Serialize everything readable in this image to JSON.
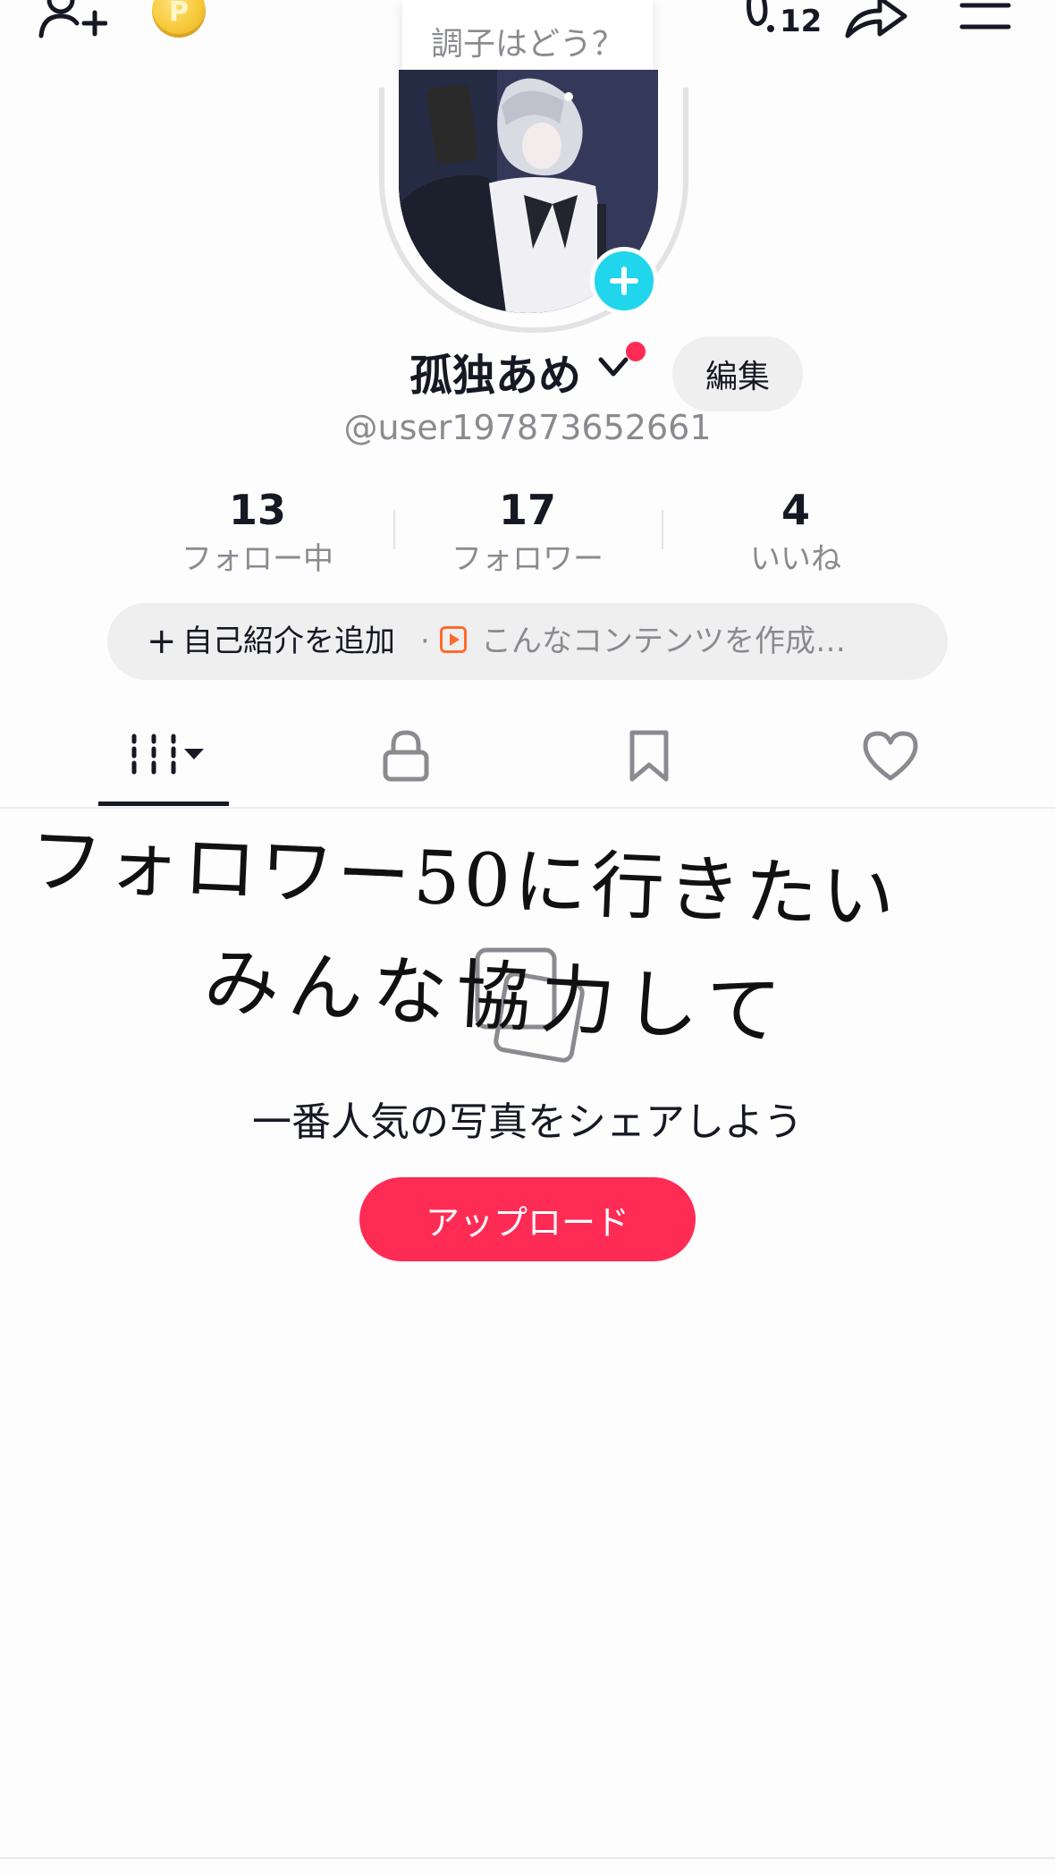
{
  "header": {
    "add_friend_icon": "person-plus-icon",
    "coin_icon": "coin-icon",
    "coin_letter": "P",
    "footprint_count": "12",
    "share_icon": "share-arrow-icon",
    "menu_icon": "hamburger-icon"
  },
  "status_bubble": {
    "text": "調子はどう？"
  },
  "profile": {
    "name": "孤独あめ",
    "edit_label": "編集",
    "handle": "@user197873652661"
  },
  "stats": [
    {
      "value": "13",
      "label": "フォロー中"
    },
    {
      "value": "17",
      "label": "フォロワー"
    },
    {
      "value": "4",
      "label": "いいね"
    }
  ],
  "bio": {
    "plus": "+",
    "add_label": "自己紹介を追加",
    "separator": "·",
    "promo_label": "こんなコンテンツを作成…"
  },
  "tabs": [
    {
      "icon": "grid-icon",
      "active": true
    },
    {
      "icon": "lock-icon",
      "active": false
    },
    {
      "icon": "bookmark-icon",
      "active": false
    },
    {
      "icon": "heart-icon",
      "active": false
    }
  ],
  "overlay_handwriting": {
    "line1": "フォロワー50に行きたい",
    "line2": "みんな協力して"
  },
  "empty_state": {
    "message": "一番人気の写真をシェアしよう",
    "upload_label": "アップロード"
  },
  "colors": {
    "accent_red": "#fe2c55",
    "badge_cyan": "#20d5ec",
    "text_primary": "#161823",
    "text_secondary": "#8a8b91"
  }
}
